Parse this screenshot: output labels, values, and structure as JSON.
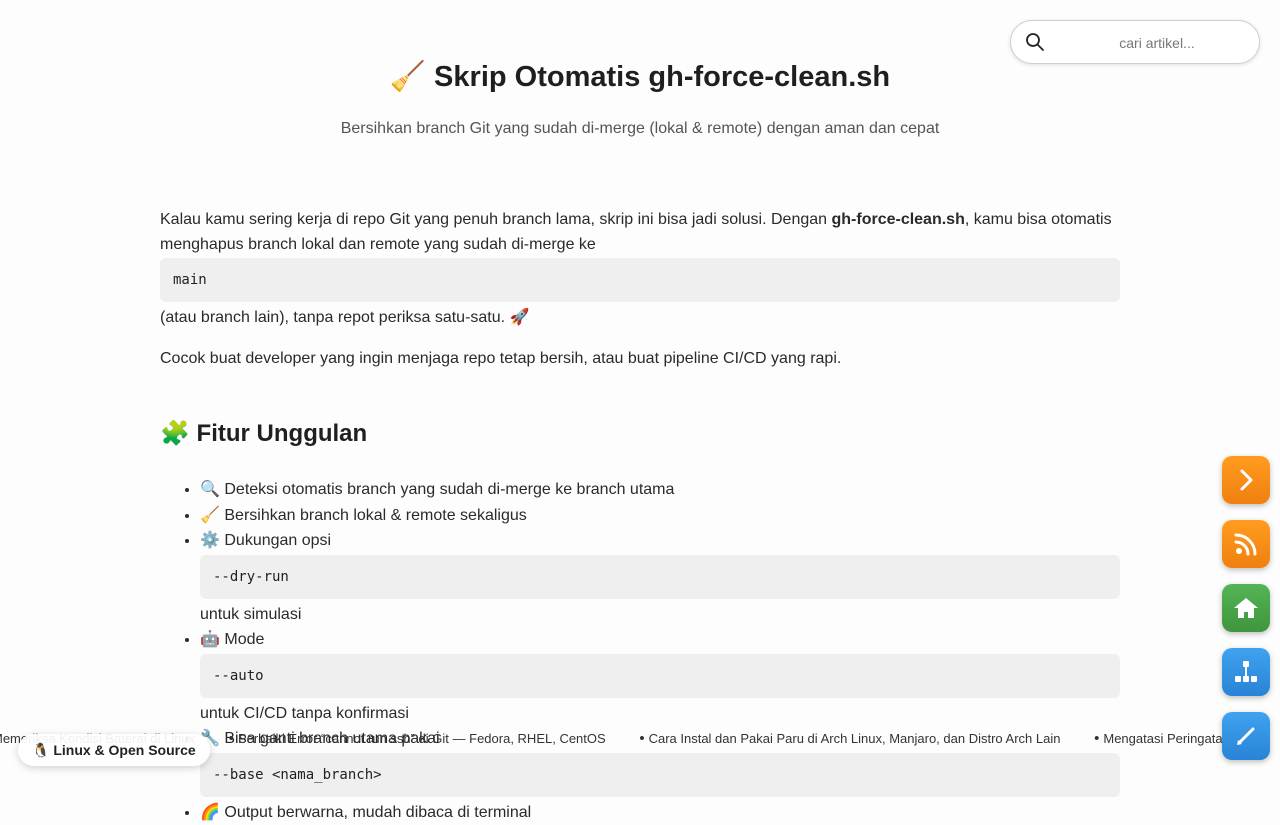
{
  "search": {
    "placeholder": "cari artikel..."
  },
  "hero": {
    "title": "🧹 Skrip Otomatis gh-force-clean.sh",
    "subtitle": "Bersihkan branch Git yang sudah di-merge (lokal & remote) dengan aman dan cepat"
  },
  "intro": {
    "text_before": "Kalau kamu sering kerja di repo Git yang penuh branch lama, skrip ini bisa jadi solusi. Dengan ",
    "bold": "gh-force-clean.sh",
    "text_after": ", kamu bisa otomatis menghapus branch lokal dan remote yang sudah di-merge ke",
    "code": "main",
    "text_tail": "(atau branch lain), tanpa repot periksa satu-satu. 🚀",
    "para2": "Cocok buat developer yang ingin menjaga repo tetap bersih, atau buat pipeline CI/CD yang rapi."
  },
  "features": {
    "heading": "🧩 Fitur Unggulan",
    "items": [
      {
        "text": "🔍 Deteksi otomatis branch yang sudah di-merge ke branch utama"
      },
      {
        "text": "🧹 Bersihkan branch lokal & remote sekaligus"
      },
      {
        "text": "⚙️ Dukungan opsi",
        "code": "--dry-run",
        "after": "untuk simulasi"
      },
      {
        "text": "🤖 Mode",
        "code": "--auto",
        "after": "untuk CI/CD tanpa konfirmasi"
      },
      {
        "text": "🔧 Bisa ganti branch utama pakai",
        "code": "--base <nama_branch>"
      },
      {
        "text": "🌈 Output berwarna, mudah dibaca di terminal"
      }
    ]
  },
  "ticker": {
    "items": [
      "Memeriksa Kondisi Baterai di Linux",
      "Perbaiki Error “cannot run ssh” di Git — Fedora, RHEL, CentOS",
      "Cara Instal dan Pakai Paru di Arch Linux, Manjaro, dan Distro Arch Lain",
      "Mengatasi Peringatan"
    ]
  },
  "badge": {
    "label": "🐧 Linux & Open Source"
  },
  "sidebar_buttons": [
    {
      "icon": "chevron-right-icon",
      "color": "#f5901a"
    },
    {
      "icon": "rss-icon",
      "color": "#f5901a"
    },
    {
      "icon": "home-icon",
      "color": "#4aa84a"
    },
    {
      "icon": "sitemap-icon",
      "color": "#3592e3"
    },
    {
      "icon": "edit-icon",
      "color": "#3592e3"
    }
  ]
}
